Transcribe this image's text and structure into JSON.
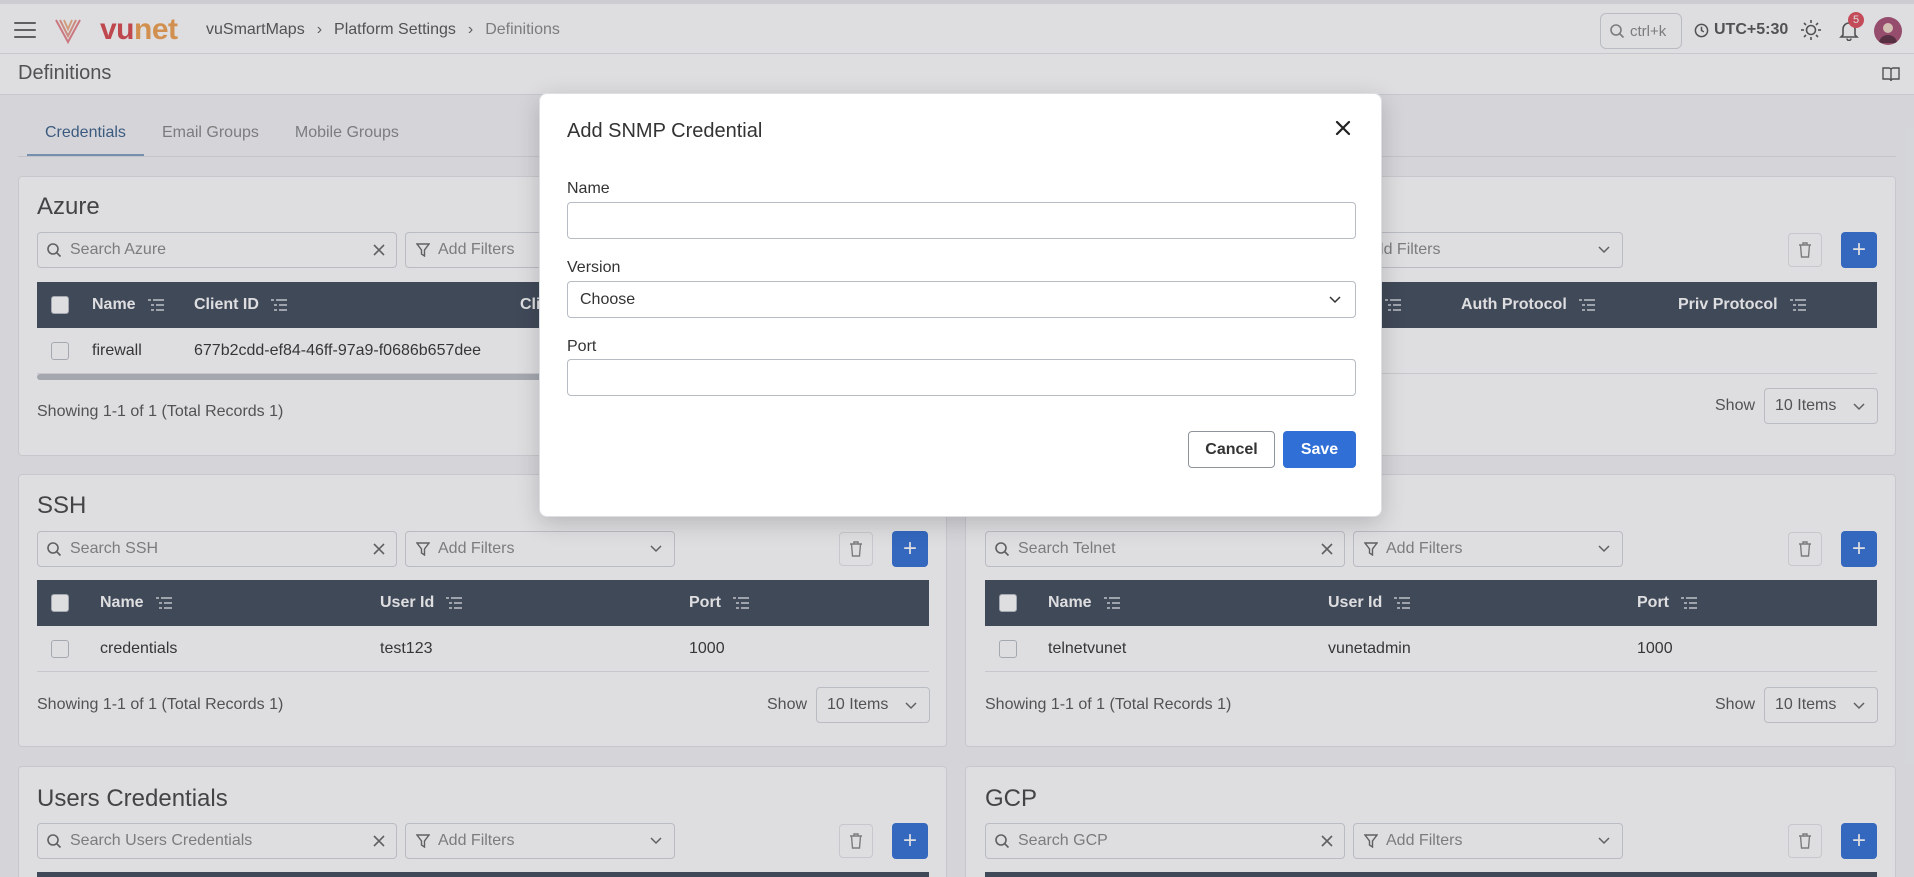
{
  "topbar": {
    "brand_vu": "vu",
    "brand_net": "net",
    "breadcrumb": [
      "vuSmartMaps",
      "Platform Settings",
      "Definitions"
    ],
    "search_shortcut": "ctrl+k",
    "timezone": "UTC+5:30",
    "notification_count": "5"
  },
  "page": {
    "title": "Definitions",
    "tabs": [
      {
        "label": "Credentials",
        "active": true
      },
      {
        "label": "Email Groups",
        "active": false
      },
      {
        "label": "Mobile Groups",
        "active": false
      }
    ]
  },
  "common": {
    "add_filters": "Add Filters",
    "show_label": "Show",
    "items_per_page": "10 Items",
    "add_symbol": "+"
  },
  "azure": {
    "title": "Azure",
    "search_placeholder": "Search Azure",
    "columns": [
      "Name",
      "Client ID",
      "Cli"
    ],
    "rows": [
      {
        "name": "firewall",
        "client_id": "677b2cdd-ef84-46ff-97a9-f0686b657dee"
      }
    ],
    "footer": "Showing 1-1 of 1 (Total Records 1)"
  },
  "snmp": {
    "columns": [
      "Auth Protocol",
      "Priv Protocol"
    ]
  },
  "ssh": {
    "title": "SSH",
    "search_placeholder": "Search SSH",
    "columns": [
      "Name",
      "User Id",
      "Port"
    ],
    "rows": [
      {
        "name": "credentials",
        "user_id": "test123",
        "port": "1000"
      }
    ],
    "footer": "Showing 1-1 of 1 (Total Records 1)"
  },
  "telnet": {
    "search_placeholder": "Search Telnet",
    "columns": [
      "Name",
      "User Id",
      "Port"
    ],
    "rows": [
      {
        "name": "telnetvunet",
        "user_id": "vunetadmin",
        "port": "1000"
      }
    ],
    "footer": "Showing 1-1 of 1 (Total Records 1)"
  },
  "users_credentials": {
    "title": "Users Credentials",
    "search_placeholder": "Search Users Credentials"
  },
  "gcp": {
    "title": "GCP",
    "search_placeholder": "Search GCP"
  },
  "modal": {
    "title": "Add SNMP Credential",
    "name_label": "Name",
    "name_value": "",
    "version_label": "Version",
    "version_value": "Choose",
    "port_label": "Port",
    "port_value": "",
    "cancel_label": "Cancel",
    "save_label": "Save"
  },
  "colors": {
    "accent": "#2f6fd6",
    "table_header": "#3f4a5a",
    "badge": "#e04c5c",
    "brand_vu": "#d9484f",
    "brand_net": "#f0a050"
  }
}
